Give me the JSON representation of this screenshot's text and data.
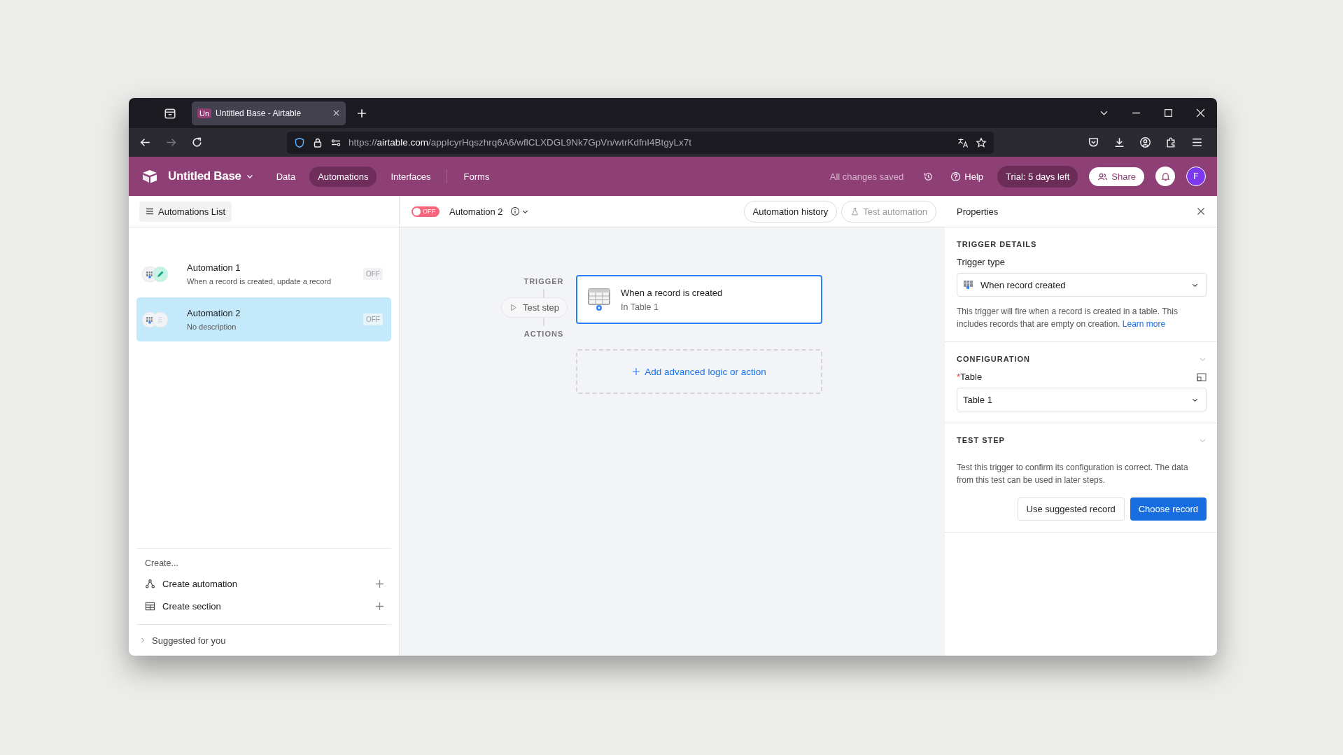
{
  "browser": {
    "tabs": [
      {
        "favicon": "Un",
        "title": "Untitled Base - Airtable",
        "selected": true
      }
    ],
    "url": {
      "scheme": "https://",
      "host": "airtable.com",
      "path": "/appIcyrHqszhrq6A6/wflCLXDGL9Nk7GpVn/wtrKdfnI4BtgyLx7t"
    }
  },
  "header": {
    "base_name": "Untitled Base",
    "nav": [
      {
        "label": "Data",
        "selected": false
      },
      {
        "label": "Automations",
        "selected": true
      },
      {
        "label": "Interfaces",
        "selected": false
      },
      {
        "label": "Forms",
        "selected": false
      }
    ],
    "save_status": "All changes saved",
    "help": "Help",
    "trial": "Trial: 5 days left",
    "share": "Share",
    "avatar": "F"
  },
  "sidebar": {
    "list_button": "Automations List",
    "automations": [
      {
        "name": "Automation 1",
        "description": "When a record is created, update a record",
        "status": "OFF",
        "kind": "update",
        "selected": false
      },
      {
        "name": "Automation 2",
        "description": "No description",
        "status": "OFF",
        "kind": "empty",
        "selected": true
      }
    ],
    "create_heading": "Create...",
    "create_items": [
      {
        "kind": "automation",
        "label": "Create automation"
      },
      {
        "kind": "section",
        "label": "Create section"
      }
    ],
    "suggested": "Suggested for you"
  },
  "toolbar": {
    "toggle": {
      "label": "OFF",
      "on": false
    },
    "automation_name": "Automation 2",
    "history_button": "Automation history",
    "test_button": {
      "label": "Test automation",
      "disabled": true
    }
  },
  "canvas": {
    "trigger_label": "TRIGGER",
    "test_step": "Test step",
    "trigger_card": {
      "title": "When a record is created",
      "subtitle": "In Table 1",
      "selected": true
    },
    "actions_label": "ACTIONS",
    "add_action": "Add advanced logic or action"
  },
  "properties": {
    "title": "Properties",
    "trigger_details": {
      "heading": "TRIGGER DETAILS",
      "field_label": "Trigger type",
      "value": "When record created",
      "help": "This trigger will fire when a record is created in a table. This includes records that are empty on creation.",
      "link": "Learn more"
    },
    "configuration": {
      "heading": "CONFIGURATION",
      "field_label": "Table",
      "required_mark": "*",
      "value": "Table 1"
    },
    "test_step": {
      "heading": "TEST STEP",
      "text": "Test this trigger to confirm its configuration is correct. The data from this test can be used in later steps.",
      "secondary_button": "Use suggested record",
      "primary_button": "Choose record"
    }
  }
}
